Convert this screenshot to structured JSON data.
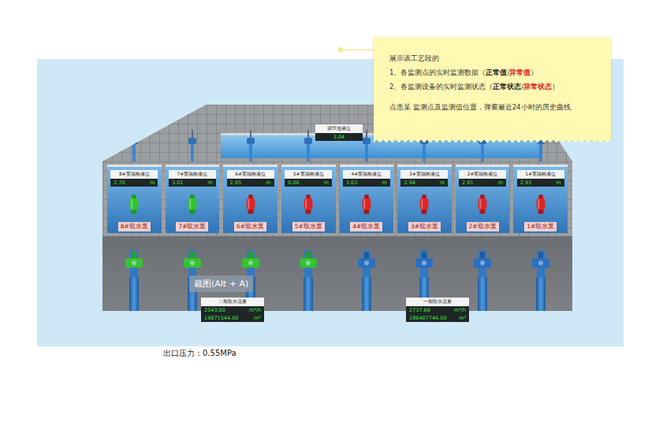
{
  "tooltip": {
    "title": "展示该工艺段的",
    "items": [
      {
        "prefix": "1、各监测点的实时监测数据（",
        "normal": "正常值",
        "sep": "/",
        "abnormal": "异常值",
        "suffix": "）"
      },
      {
        "prefix": "2、各监测设备的实时监测状态（",
        "normal": "正常状态",
        "sep": "/",
        "abnormal": "异常状态",
        "suffix": "）"
      }
    ],
    "note": "点击某 监测点及监测值位置，弹窗最近24小时的历史曲线"
  },
  "pool": {
    "label": "调节池液位",
    "value": "3.04"
  },
  "bays": [
    {
      "label": "8#泵隔舱液位",
      "value": "2.70",
      "unit": "m",
      "pump": "8#取水泵",
      "running": true,
      "valve_open": true
    },
    {
      "label": "7#泵隔舱液位",
      "value": "3.01",
      "unit": "m",
      "pump": "7#取水泵",
      "running": true,
      "valve_open": true
    },
    {
      "label": "6#泵隔舱液位",
      "value": "2.95",
      "unit": "m",
      "pump": "6#取水泵",
      "running": false,
      "valve_open": true
    },
    {
      "label": "5#泵隔舱液位",
      "value": "0.00",
      "unit": "m",
      "pump": "5#取水泵",
      "running": false,
      "valve_open": true
    },
    {
      "label": "4#泵隔舱液位",
      "value": "3.03",
      "unit": "m",
      "pump": "4#取水泵",
      "running": false,
      "valve_open": false
    },
    {
      "label": "3#泵隔舱液位",
      "value": "2.94",
      "unit": "m",
      "pump": "3#取水泵",
      "running": false,
      "valve_open": false
    },
    {
      "label": "2#泵隔舱液位",
      "value": "2.91",
      "unit": "m",
      "pump": "2#取水泵",
      "running": false,
      "valve_open": false
    },
    {
      "label": "1#泵隔舱液位",
      "value": "2.93",
      "unit": "m",
      "pump": "1#取水泵",
      "running": false,
      "valve_open": false
    }
  ],
  "flows": [
    {
      "label": "二期取水流量",
      "rate": "2543.00",
      "rate_unit": "m³/h",
      "total": "19871544.00",
      "total_unit": "m³"
    },
    {
      "label": "一期取水流量",
      "rate": "2737.66",
      "rate_unit": "m³/h",
      "total": "186487744.00",
      "total_unit": "m³"
    }
  ],
  "pressure": "出口压力：0.55MPa",
  "overlay": {
    "label": "裁图(Alt + A)"
  }
}
